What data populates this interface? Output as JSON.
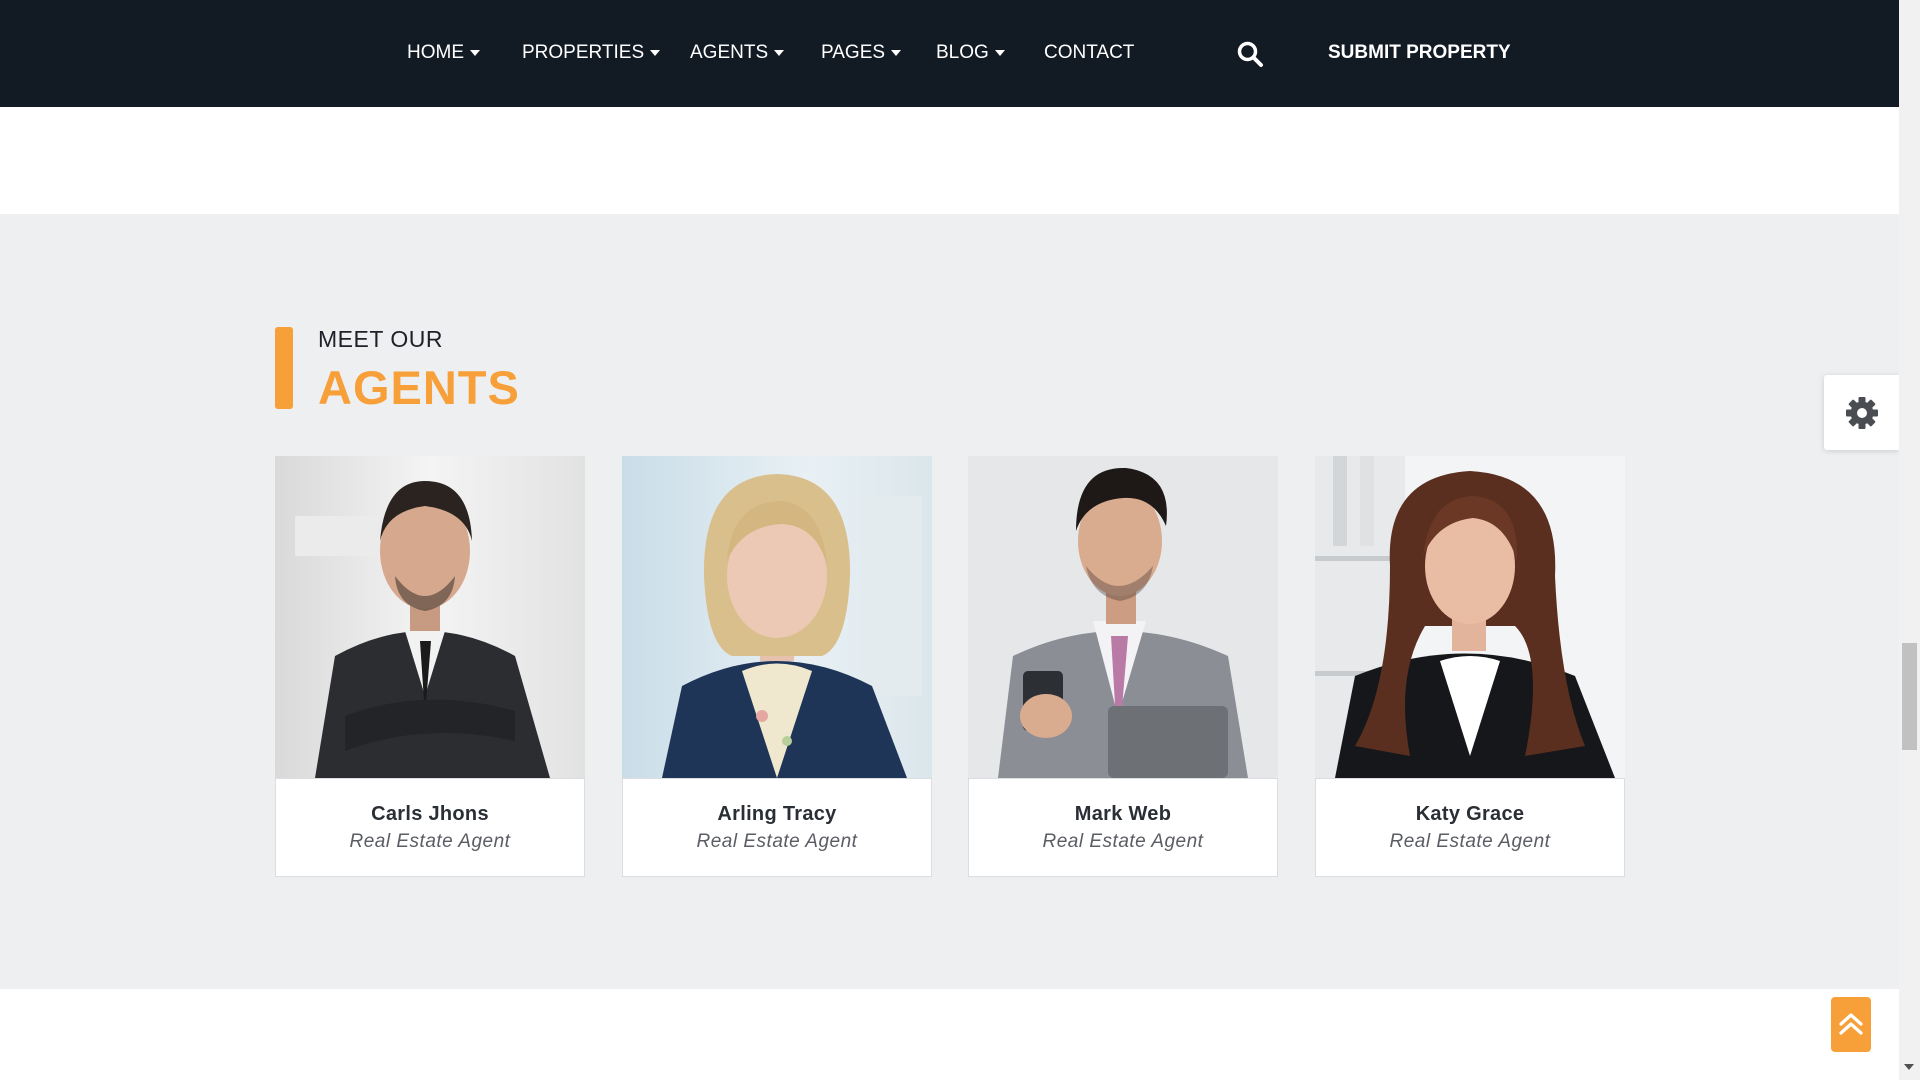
{
  "nav": {
    "items": [
      {
        "label": "HOME",
        "dropdown": true
      },
      {
        "label": "PROPERTIES",
        "dropdown": true
      },
      {
        "label": "AGENTS",
        "dropdown": true
      },
      {
        "label": "PAGES",
        "dropdown": true
      },
      {
        "label": "BLOG",
        "dropdown": true
      },
      {
        "label": "CONTACT",
        "dropdown": false
      }
    ],
    "search_icon": "search-icon",
    "submit_label": "SUBMIT PROPERTY"
  },
  "agents_section": {
    "heading_small": "MEET OUR",
    "heading_big": "AGENTS",
    "agents": [
      {
        "name": "Carls Jhons",
        "role": "Real Estate Agent"
      },
      {
        "name": "Arling Tracy",
        "role": "Real Estate Agent"
      },
      {
        "name": "Mark Web",
        "role": "Real Estate Agent"
      },
      {
        "name": "Katy Grace",
        "role": "Real Estate Agent"
      }
    ]
  },
  "widgets": {
    "settings_icon": "gear-icon",
    "back_to_top_icon": "double-chevron-up-icon"
  },
  "colors": {
    "nav_bg": "#121a24",
    "accent": "#f7a03a",
    "section_bg": "#eeeff1"
  }
}
